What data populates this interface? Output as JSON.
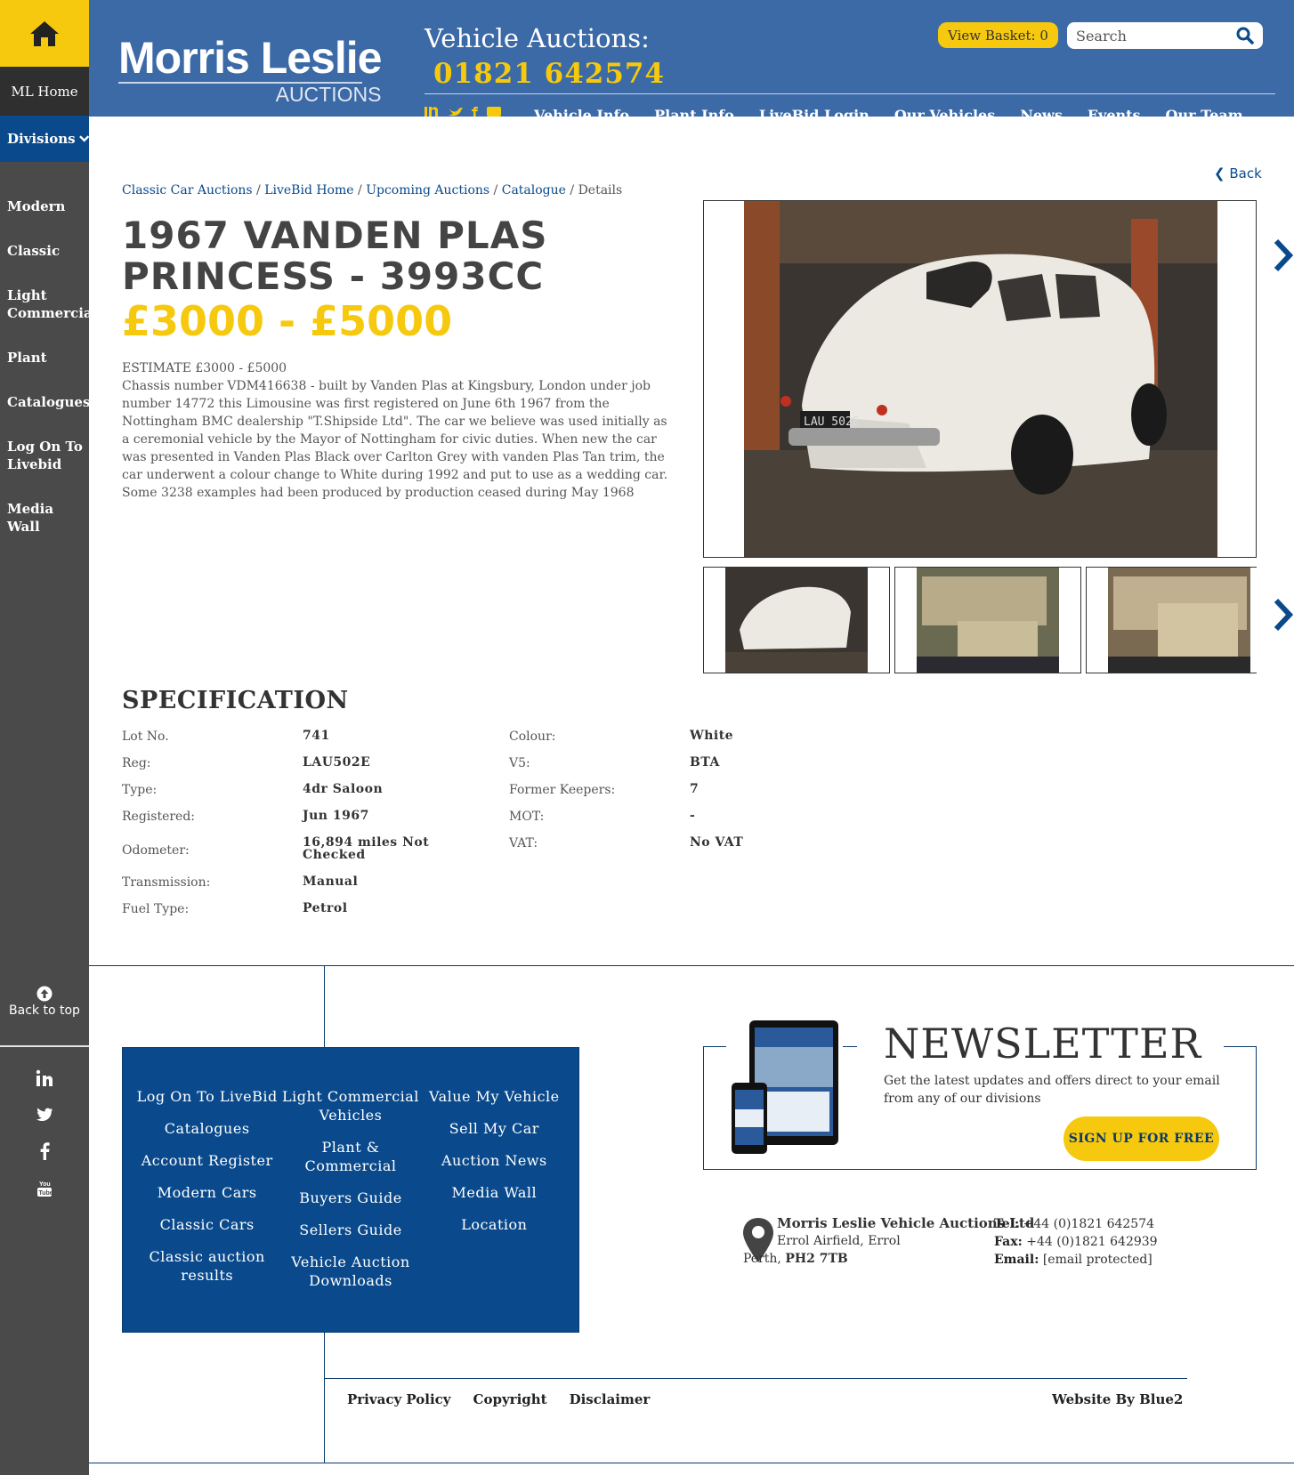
{
  "sidebar": {
    "home_label": "ML Home",
    "divisions_label": "Divisions",
    "items": [
      {
        "label": "Modern"
      },
      {
        "label": "Classic"
      },
      {
        "label": "Light\nCommercial"
      },
      {
        "label": "Plant"
      },
      {
        "label": "Catalogues"
      },
      {
        "label": "Log On To\nLivebid"
      },
      {
        "label": "Media Wall"
      }
    ],
    "back_to_top": "Back to top",
    "social_icons": [
      "linkedin-icon",
      "twitter-icon",
      "facebook-icon",
      "youtube-icon"
    ]
  },
  "header": {
    "logo_name": "Morris Leslie",
    "logo_sub": "AUCTIONS",
    "vehicle_auctions_label": "Vehicle Auctions:",
    "phone": "01821 642574",
    "basket_label": "View Basket: ",
    "basket_count": "0",
    "search_placeholder": "Search",
    "nav": [
      "Vehicle Info",
      "Plant Info",
      "LiveBid Login",
      "Our Vehicles",
      "News",
      "Events",
      "Our Team"
    ]
  },
  "breadcrumb": {
    "items": [
      "Classic Car Auctions",
      "LiveBid Home",
      "Upcoming Auctions",
      "Catalogue"
    ],
    "current": "Details",
    "back_label": "Back"
  },
  "lot": {
    "title": "1967 VANDEN PLAS PRINCESS - 3993CC",
    "price": "£3000 - £5000",
    "estimate": "ESTIMATE £3000 - £5000",
    "description": "Chassis number VDM416638 - built by Vanden Plas at Kingsbury, London under job number 14772 this Limousine was first registered on June 6th 1967 from the Nottingham BMC dealership \"T.Shipside Ltd\". The car we believe was used initially as a ceremonial vehicle by the Mayor of Nottingham for civic duties. When new the car was presented in Vanden Plas Black over Carlton Grey with vanden Plas Tan trim, the car underwent a colour change to White during 1992 and put to use as a wedding car. Some 3238 examples had been produced by production ceased during May 1968",
    "main_image_plate": "LAU 502E"
  },
  "specification": {
    "title": "SPECIFICATION",
    "left": [
      {
        "label": "Lot No.",
        "value": "741"
      },
      {
        "label": "Reg:",
        "value": "LAU502E"
      },
      {
        "label": "Type:",
        "value": "4dr Saloon"
      },
      {
        "label": "Registered:",
        "value": "Jun 1967"
      },
      {
        "label": "Odometer:",
        "value": "16,894 miles Not Checked"
      },
      {
        "label": "Transmission:",
        "value": "Manual"
      },
      {
        "label": "Fuel Type:",
        "value": "Petrol"
      }
    ],
    "right": [
      {
        "label": "Colour:",
        "value": "White"
      },
      {
        "label": "V5:",
        "value": "BTA"
      },
      {
        "label": "Former Keepers:",
        "value": "7"
      },
      {
        "label": "MOT:",
        "value": "-"
      },
      {
        "label": "VAT:",
        "value": "No VAT"
      }
    ]
  },
  "footer": {
    "links": [
      [
        "Log On To LiveBid",
        "Catalogues",
        "Account Register",
        "Modern Cars",
        "Classic Cars",
        "Classic auction results"
      ],
      [
        "Light Commercial Vehicles",
        "Plant & Commercial",
        "Buyers Guide",
        "Sellers Guide",
        "Vehicle Auction Downloads"
      ],
      [
        "Value My Vehicle",
        "Sell My Car",
        "Auction News",
        "Media Wall",
        "Location"
      ]
    ],
    "newsletter": {
      "title": "NEWSLETTER",
      "text": "Get the latest updates and offers direct to your email from any of our divisions",
      "button": "SIGN UP FOR FREE"
    },
    "contact": {
      "company": "Morris Leslie Vehicle Auctions Ltd",
      "address_line": "Errol Airfield, Errol",
      "city": "Perth,",
      "postcode": "PH2 7TB",
      "tel_label": "Tel:",
      "tel": "+44 (0)1821 642574",
      "fax_label": "Fax:",
      "fax": "+44 (0)1821 642939",
      "email_label": "Email:",
      "email": "[email protected]"
    },
    "legal": [
      "Privacy Policy",
      "Copyright",
      "Disclaimer"
    ],
    "website_by": "Website By Blue2"
  },
  "colors": {
    "brand_blue": "#3b6aa7",
    "dark_blue": "#0a4a8c",
    "accent_yellow": "#f6c90e",
    "sidebar_grey": "#4a4a4a"
  }
}
